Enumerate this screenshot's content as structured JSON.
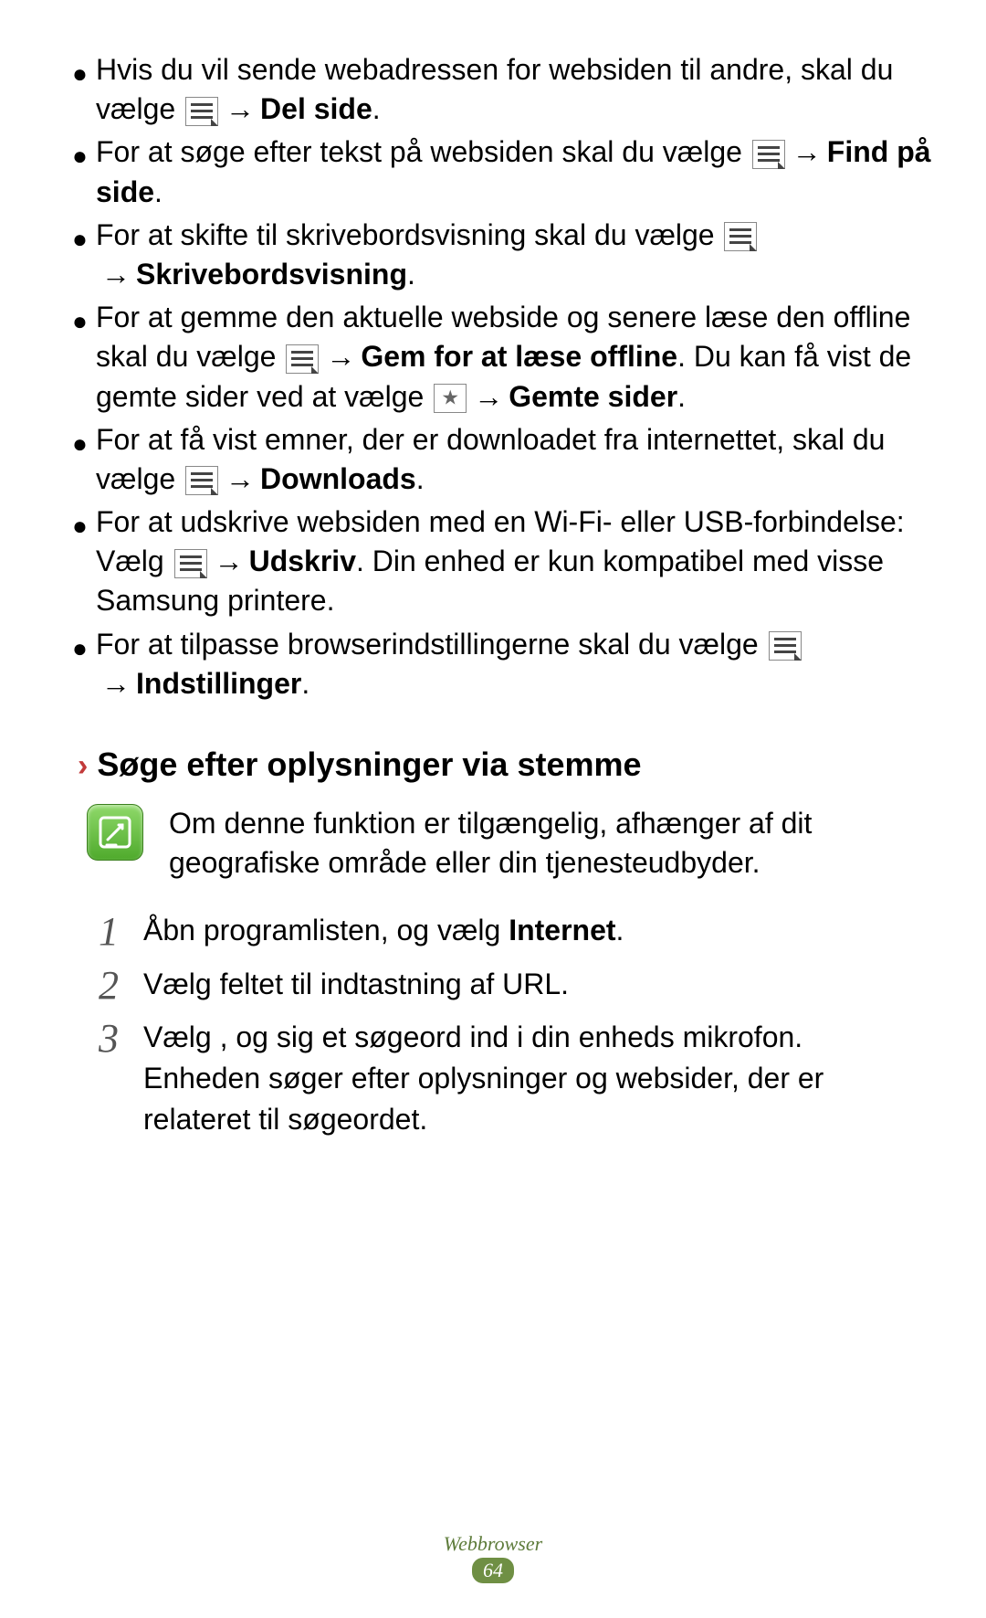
{
  "bullets": [
    {
      "pre": "Hvis du vil sende webadressen for websiden til andre, skal du vælge ",
      "icon": "menu",
      "arrow": "→",
      "bold": "Del side",
      "post": "."
    },
    {
      "pre": "For at søge efter tekst på websiden skal du vælge ",
      "icon": "menu",
      "arrow": "→",
      "bold": "Find på side",
      "post": "."
    },
    {
      "pre": "For at skifte til skrivebordsvisning skal du vælge ",
      "icon": "menu",
      "arrow": "→",
      "bold": "Skrivebordsvisning",
      "post": "."
    },
    {
      "pre": "For at gemme den aktuelle webside og senere læse den offline skal du vælge ",
      "icon": "menu",
      "arrow": "→",
      "bold": "Gem for at læse offline",
      "mid": ". Du kan få vist de gemte sider ved at vælge ",
      "icon2": "star",
      "arrow2": "→",
      "bold2": "Gemte sider",
      "post": "."
    },
    {
      "pre": "For at få vist emner, der er downloadet fra internettet, skal du vælge ",
      "icon": "menu",
      "arrow": "→",
      "bold": "Downloads",
      "post": "."
    },
    {
      "pre": "For at udskrive websiden med en Wi-Fi- eller USB-forbindelse: Vælg ",
      "icon": "menu",
      "arrow": "→",
      "bold": "Udskriv",
      "post": ". Din enhed er kun kompatibel med visse Samsung printere."
    },
    {
      "pre": "For at tilpasse browserindstillingerne skal du vælge ",
      "icon": "menu",
      "arrow": "→",
      "bold": "Indstillinger",
      "post": "."
    }
  ],
  "section": {
    "chevron": "›",
    "title": "Søge efter oplysninger via stemme"
  },
  "note": {
    "text": "Om denne funktion er tilgængelig, afhænger af dit geografiske område eller din tjenesteudbyder."
  },
  "steps": [
    {
      "num": "1",
      "pre": "Åbn programlisten, og vælg ",
      "bold": "Internet",
      "post": "."
    },
    {
      "num": "2",
      "text": "Vælg feltet til indtastning af URL."
    },
    {
      "num": "3",
      "pre": "Vælg ",
      "gap": "   ",
      "mid": ", og sig et søgeord ind i din enheds mikrofon.",
      "line2": "Enheden søger efter oplysninger og websider, der er relateret til søgeordet."
    }
  ],
  "footer": {
    "category": "Webbrowser",
    "page": "64"
  }
}
